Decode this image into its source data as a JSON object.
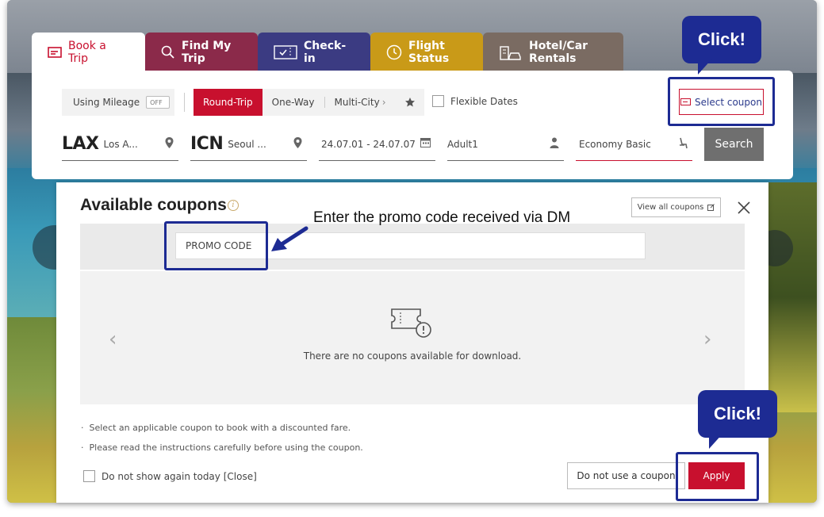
{
  "tabs": [
    {
      "label": "Book a Trip"
    },
    {
      "label": "Find My Trip"
    },
    {
      "label": "Check-in"
    },
    {
      "label": "Flight Status"
    },
    {
      "label": "Hotel/Car Rentals"
    }
  ],
  "booking": {
    "mileage_label": "Using Mileage",
    "mileage_toggle": "OFF",
    "trip_types": [
      "Round-Trip",
      "One-Way",
      "Multi-City"
    ],
    "flexible_dates": "Flexible Dates",
    "select_coupon": "Select coupon",
    "origin_code": "LAX",
    "origin_city": "Los A...",
    "dest_code": "ICN",
    "dest_city": "Seoul ...",
    "dates": "24.07.01 - 24.07.07",
    "passengers": "Adult1",
    "cabin": "Economy Basic",
    "search": "Search"
  },
  "modal": {
    "title": "Available coupons",
    "info_glyph": "i",
    "view_all": "View all coupons",
    "promo_placeholder": "PROMO CODE",
    "empty_message": "There are no coupons available for download.",
    "notes": [
      "Select an applicable coupon to book with a discounted fare.",
      "Please read the instructions carefully before using the coupon."
    ],
    "no_show": "Do not show again today [Close]",
    "no_coupon": "Do not use a coupon",
    "apply": "Apply"
  },
  "annotations": {
    "click_top": "Click!",
    "click_bottom": "Click!",
    "promo_hint": "Enter the promo code received via DM"
  },
  "colors": {
    "brand_red": "#c8102e",
    "annotation_blue": "#1d2b93"
  }
}
